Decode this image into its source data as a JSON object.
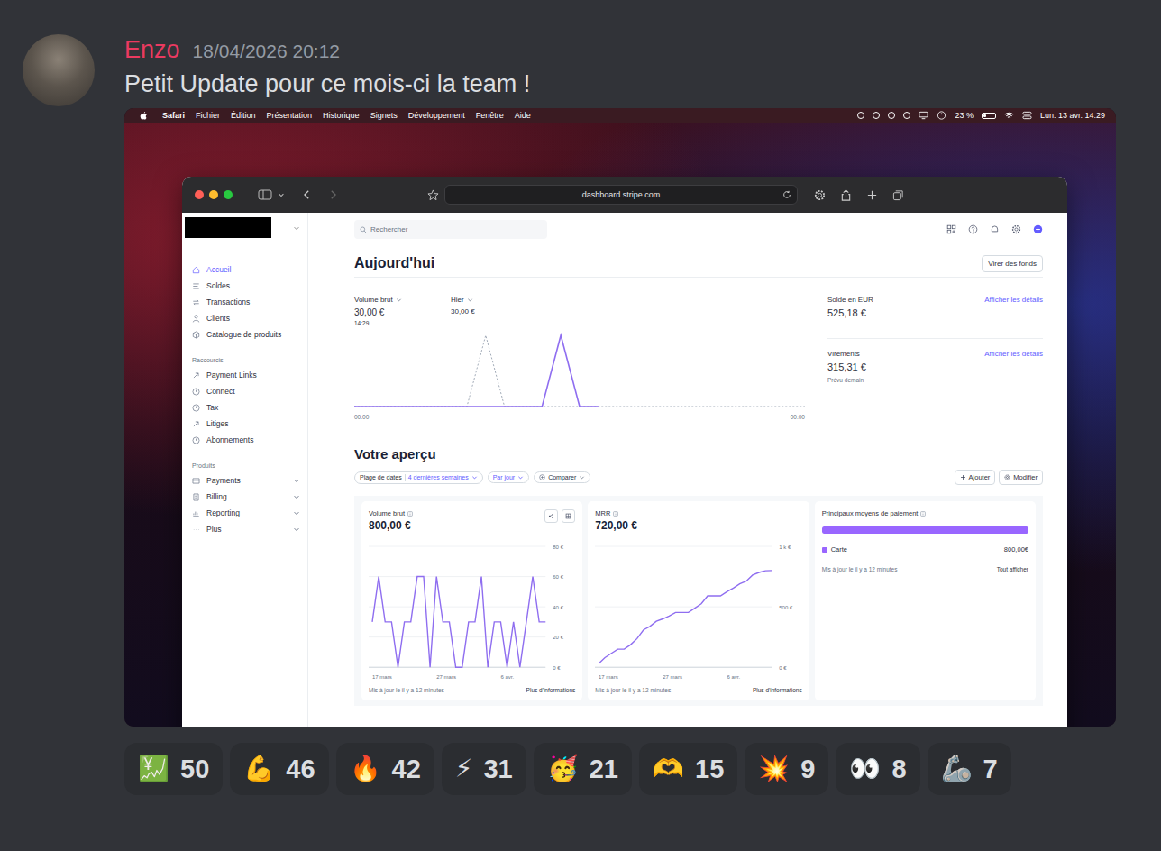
{
  "message": {
    "author": "Enzo",
    "timestamp": "18/04/2026 20:12",
    "text": "Petit Update pour ce mois-ci la team !"
  },
  "screenshot": {
    "menubar": {
      "items": [
        {
          "label": "Safari",
          "kind": "app"
        },
        {
          "label": "Fichier",
          "kind": "menu"
        },
        {
          "label": "Édition",
          "kind": "menu"
        },
        {
          "label": "Présentation",
          "kind": "menu"
        },
        {
          "label": "Historique",
          "kind": "menu"
        },
        {
          "label": "Signets",
          "kind": "menu"
        },
        {
          "label": "Développement",
          "kind": "menu"
        },
        {
          "label": "Fenêtre",
          "kind": "menu"
        },
        {
          "label": "Aide",
          "kind": "menu"
        }
      ],
      "battery": "23 %",
      "battery_level": 0.23,
      "clock": "Lun. 13 avr. 14:29"
    },
    "browser": {
      "url": "dashboard.stripe.com"
    },
    "stripe": {
      "search": {
        "placeholder": "Rechercher"
      },
      "sidebar": {
        "items": [
          {
            "label": "Accueil",
            "selected": true
          },
          {
            "label": "Soldes",
            "selected": false
          },
          {
            "label": "Transactions",
            "selected": false
          },
          {
            "label": "Clients",
            "selected": false
          },
          {
            "label": "Catalogue de produits",
            "selected": false
          }
        ],
        "sections": [
          {
            "title": "Raccourcis",
            "items": [
              {
                "label": "Payment Links",
                "collapsible": false,
                "expanded": false
              },
              {
                "label": "Connect",
                "collapsible": false,
                "expanded": false
              },
              {
                "label": "Tax",
                "collapsible": false,
                "expanded": false
              },
              {
                "label": "Litiges",
                "collapsible": false,
                "expanded": false
              },
              {
                "label": "Abonnements",
                "collapsible": false,
                "expanded": false
              }
            ]
          },
          {
            "title": "Produits",
            "items": [
              {
                "label": "Payments",
                "collapsible": true,
                "expanded": false
              },
              {
                "label": "Billing",
                "collapsible": true,
                "expanded": false
              },
              {
                "label": "Reporting",
                "collapsible": true,
                "expanded": false
              },
              {
                "label": "Plus",
                "collapsible": true,
                "expanded": false
              }
            ]
          }
        ]
      },
      "today": {
        "title": "Aujourd'hui",
        "button": "Virer des fonds",
        "gross": {
          "label": "Volume brut",
          "value": "30,00 €",
          "time": "14:29"
        },
        "compare": {
          "label": "Hier",
          "value": "30,00 €"
        },
        "axis": [
          "00:00",
          "00:00"
        ],
        "max": 30,
        "today_values": [
          0,
          0,
          0,
          0,
          0,
          0,
          0,
          0,
          0,
          0,
          0,
          30,
          0,
          0
        ],
        "compare_values": [
          0,
          0,
          0,
          0,
          0,
          0,
          0,
          30,
          0,
          0,
          0,
          0,
          0,
          0,
          0,
          0,
          0,
          0,
          0,
          0,
          0,
          0,
          0,
          0,
          0
        ],
        "balance": {
          "label": "Solde en EUR",
          "value": "525,18 €",
          "link": "Afficher les détails"
        },
        "payouts": {
          "label": "Virements",
          "value": "315,31 €",
          "note": "Prévu demain",
          "link": "Afficher les détails"
        }
      },
      "overview": {
        "title": "Votre aperçu",
        "range": {
          "label": "Plage de dates",
          "value": "4 dernières semaines"
        },
        "interval": "Par jour",
        "compare": "Comparer",
        "actions": [
          "Ajouter",
          "Modifier"
        ],
        "cards": [
          {
            "kind": "chart",
            "title": "Volume brut",
            "value": "800,00 €",
            "actions": true,
            "ticks": [
              "80 €",
              "60 €",
              "40 €",
              "20 €",
              "0 €"
            ],
            "max": 80,
            "x_labels": [
              {
                "label": "17 mars",
                "at": 0
              },
              {
                "label": "27 mars",
                "at": 10
              },
              {
                "label": "6 avr.",
                "at": 20
              }
            ],
            "values": [
              30,
              60,
              30,
              30,
              0,
              30,
              30,
              60,
              60,
              0,
              60,
              30,
              30,
              0,
              0,
              30,
              30,
              60,
              0,
              30,
              30,
              0,
              30,
              0,
              30,
              60,
              30,
              30
            ],
            "updated": "Mis à jour le il y a 12 minutes",
            "link": "Plus d'informations"
          },
          {
            "kind": "chart",
            "title": "MRR",
            "value": "720,00 €",
            "actions": false,
            "ticks": [
              "1 k €",
              "500 €",
              "0 €"
            ],
            "max": 1000,
            "x_labels": [
              {
                "label": "17 mars",
                "at": 0
              },
              {
                "label": "27 mars",
                "at": 10
              },
              {
                "label": "6 avr.",
                "at": 20
              }
            ],
            "values": [
              30,
              80,
              115,
              150,
              150,
              187,
              237,
              309,
              338,
              381,
              400,
              424,
              453,
              453,
              453,
              489,
              525,
              590,
              590,
              590,
              625,
              654,
              690,
              712,
              762,
              784,
              798,
              800
            ],
            "updated": "Mis à jour le il y a 12 minutes",
            "link": "Plus d'informations"
          },
          {
            "kind": "methods",
            "title": "Principaux moyens de paiement",
            "value": "",
            "actions": false,
            "ticks": [],
            "max": 1,
            "x_labels": [],
            "values": [],
            "methods": [
              {
                "label": "Carte",
                "amount": "800,00€",
                "level": 1
              }
            ],
            "updated": "Mis à jour le il y a 12 minutes",
            "link": "Tout afficher"
          }
        ]
      }
    }
  },
  "reactions": [
    {
      "emoji": "💹",
      "count": "50",
      "selected": false
    },
    {
      "emoji": "💪",
      "count": "46",
      "selected": false
    },
    {
      "emoji": "🔥",
      "count": "42",
      "selected": false
    },
    {
      "emoji": "⚡",
      "count": "31",
      "selected": false
    },
    {
      "emoji": "🥳",
      "count": "21",
      "selected": false
    },
    {
      "emoji": "🫶",
      "count": "15",
      "selected": false
    },
    {
      "emoji": "💥",
      "count": "9",
      "selected": false
    },
    {
      "emoji": "👀",
      "count": "8",
      "selected": false
    },
    {
      "emoji": "🦾",
      "count": "7",
      "selected": false
    }
  ]
}
